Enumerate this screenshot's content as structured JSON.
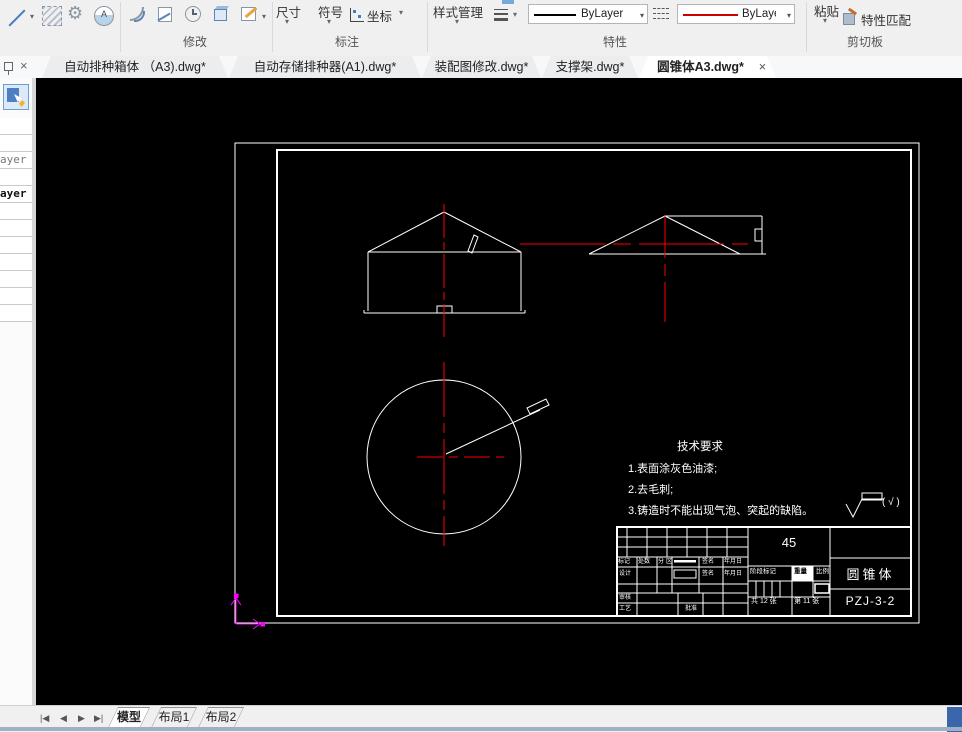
{
  "ribbon": {
    "modify_label": "修改",
    "annotate_label": "标注",
    "properties_label": "特性",
    "clipboard_label": "剪切板",
    "dimension": "尺寸",
    "symbol": "符号",
    "coordinate": "坐标",
    "style_manager": "样式管理",
    "color_value": "ByLayer",
    "linetype_value": "ByLayer",
    "paste": "粘贴",
    "match_properties": "特性匹配"
  },
  "doc_tabs": {
    "tab1": "自动排种箱体 （A3).dwg*",
    "tab2": "自动存储排种器(A1).dwg*",
    "tab3": "装配图修改.dwg*",
    "tab4": "支撑架.dwg*",
    "tab5": "圆锥体A3.dwg*"
  },
  "palette": {
    "row3_text": "ayer",
    "row5_text": "ayer"
  },
  "drawing": {
    "tech_requirements": {
      "title": "技术要求",
      "line1": "1.表面涂灰色油漆;",
      "line2": "2.去毛刺;",
      "line3": "3.铸造时不能出现气泡、突起的缺陷。"
    },
    "surface_note": "( √ )",
    "title_block": {
      "material": "45",
      "part_name": "圆锥体",
      "drawing_number": "PZJ-3-2",
      "mark": "标记",
      "count": "处数",
      "zone_a": "分",
      "zone_b": "区",
      "sign": "签名",
      "date": "年月日",
      "design": "设计",
      "sign2": "签名",
      "date2": "年月日",
      "review": "审核",
      "process": "工艺",
      "approve": "批准",
      "stage_mark": "阶段标记",
      "weight": "重量",
      "scale": "比例",
      "total_sheets": "共 12 张",
      "sheet_number": "第 11 张"
    }
  },
  "status_bar": {
    "model_tab": "模型",
    "layout1_tab": "布局1",
    "layout2_tab": "布局2",
    "nav_first": "|◀",
    "nav_prev": "◀",
    "nav_next": "▶",
    "nav_last": "▶|"
  },
  "icons": {
    "dropdown": "▾",
    "close": "×"
  },
  "colors": {
    "canvas": "#000000",
    "drawing_line": "#ffffff",
    "centerline": "#ff0000",
    "ucs": "#ff00ff",
    "color_sample_black": "#000000",
    "linetype_sample_red": "#cc0000"
  }
}
